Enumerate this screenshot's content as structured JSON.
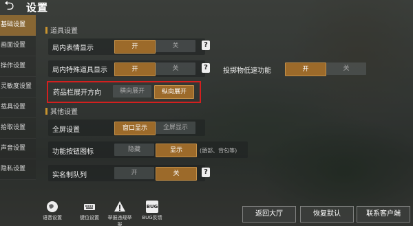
{
  "header": {
    "back": "⮌",
    "title": "设置"
  },
  "sidebar": {
    "items": [
      {
        "label": "基础设置",
        "active": true
      },
      {
        "label": "画面设置",
        "active": false
      },
      {
        "label": "操作设置",
        "active": false
      },
      {
        "label": "灵敏度设置",
        "active": false
      },
      {
        "label": "载具设置",
        "active": false
      },
      {
        "label": "拾取设置",
        "active": false
      },
      {
        "label": "声音设置",
        "active": false
      },
      {
        "label": "隐私设置",
        "active": false
      }
    ]
  },
  "sections": {
    "item": "道具设置",
    "other": "其他设置"
  },
  "rows": {
    "expression": {
      "label": "局内表情显示",
      "on": "开",
      "off": "关"
    },
    "special_item": {
      "label": "局内特殊道具显示",
      "on": "开",
      "off": "关"
    },
    "drop_item": {
      "label": "投掷物低速功能",
      "on": "开",
      "off": "关"
    },
    "medicine": {
      "label": "药品栏展开方向",
      "horizontal": "横向展开",
      "vertical": "纵向展开"
    },
    "fullscreen": {
      "label": "全屏设置",
      "window": "窗口显示",
      "full": "全屏显示"
    },
    "func_btn": {
      "label": "功能按钮图标",
      "hide": "隐藏",
      "show": "显示",
      "note": "(頭部、背包等)"
    },
    "realname": {
      "label": "实名制队列",
      "on": "开",
      "off": "关"
    }
  },
  "help_glyph": "?",
  "bottom_icons": [
    {
      "label": "语音设置",
      "icon": "globe-icon"
    },
    {
      "label": "键位设置",
      "icon": "keyboard-icon"
    },
    {
      "label": "举报违规举报",
      "icon": "warning-icon"
    },
    {
      "label": "BUG反馈",
      "icon": "bug-icon",
      "badge": "BUG"
    }
  ],
  "bottom_buttons": {
    "lobby": "返回大厅",
    "default": "恢复默认",
    "service": "联系客户端"
  },
  "colors": {
    "accent": "#9c6a2a",
    "highlight": "#d3201f"
  }
}
